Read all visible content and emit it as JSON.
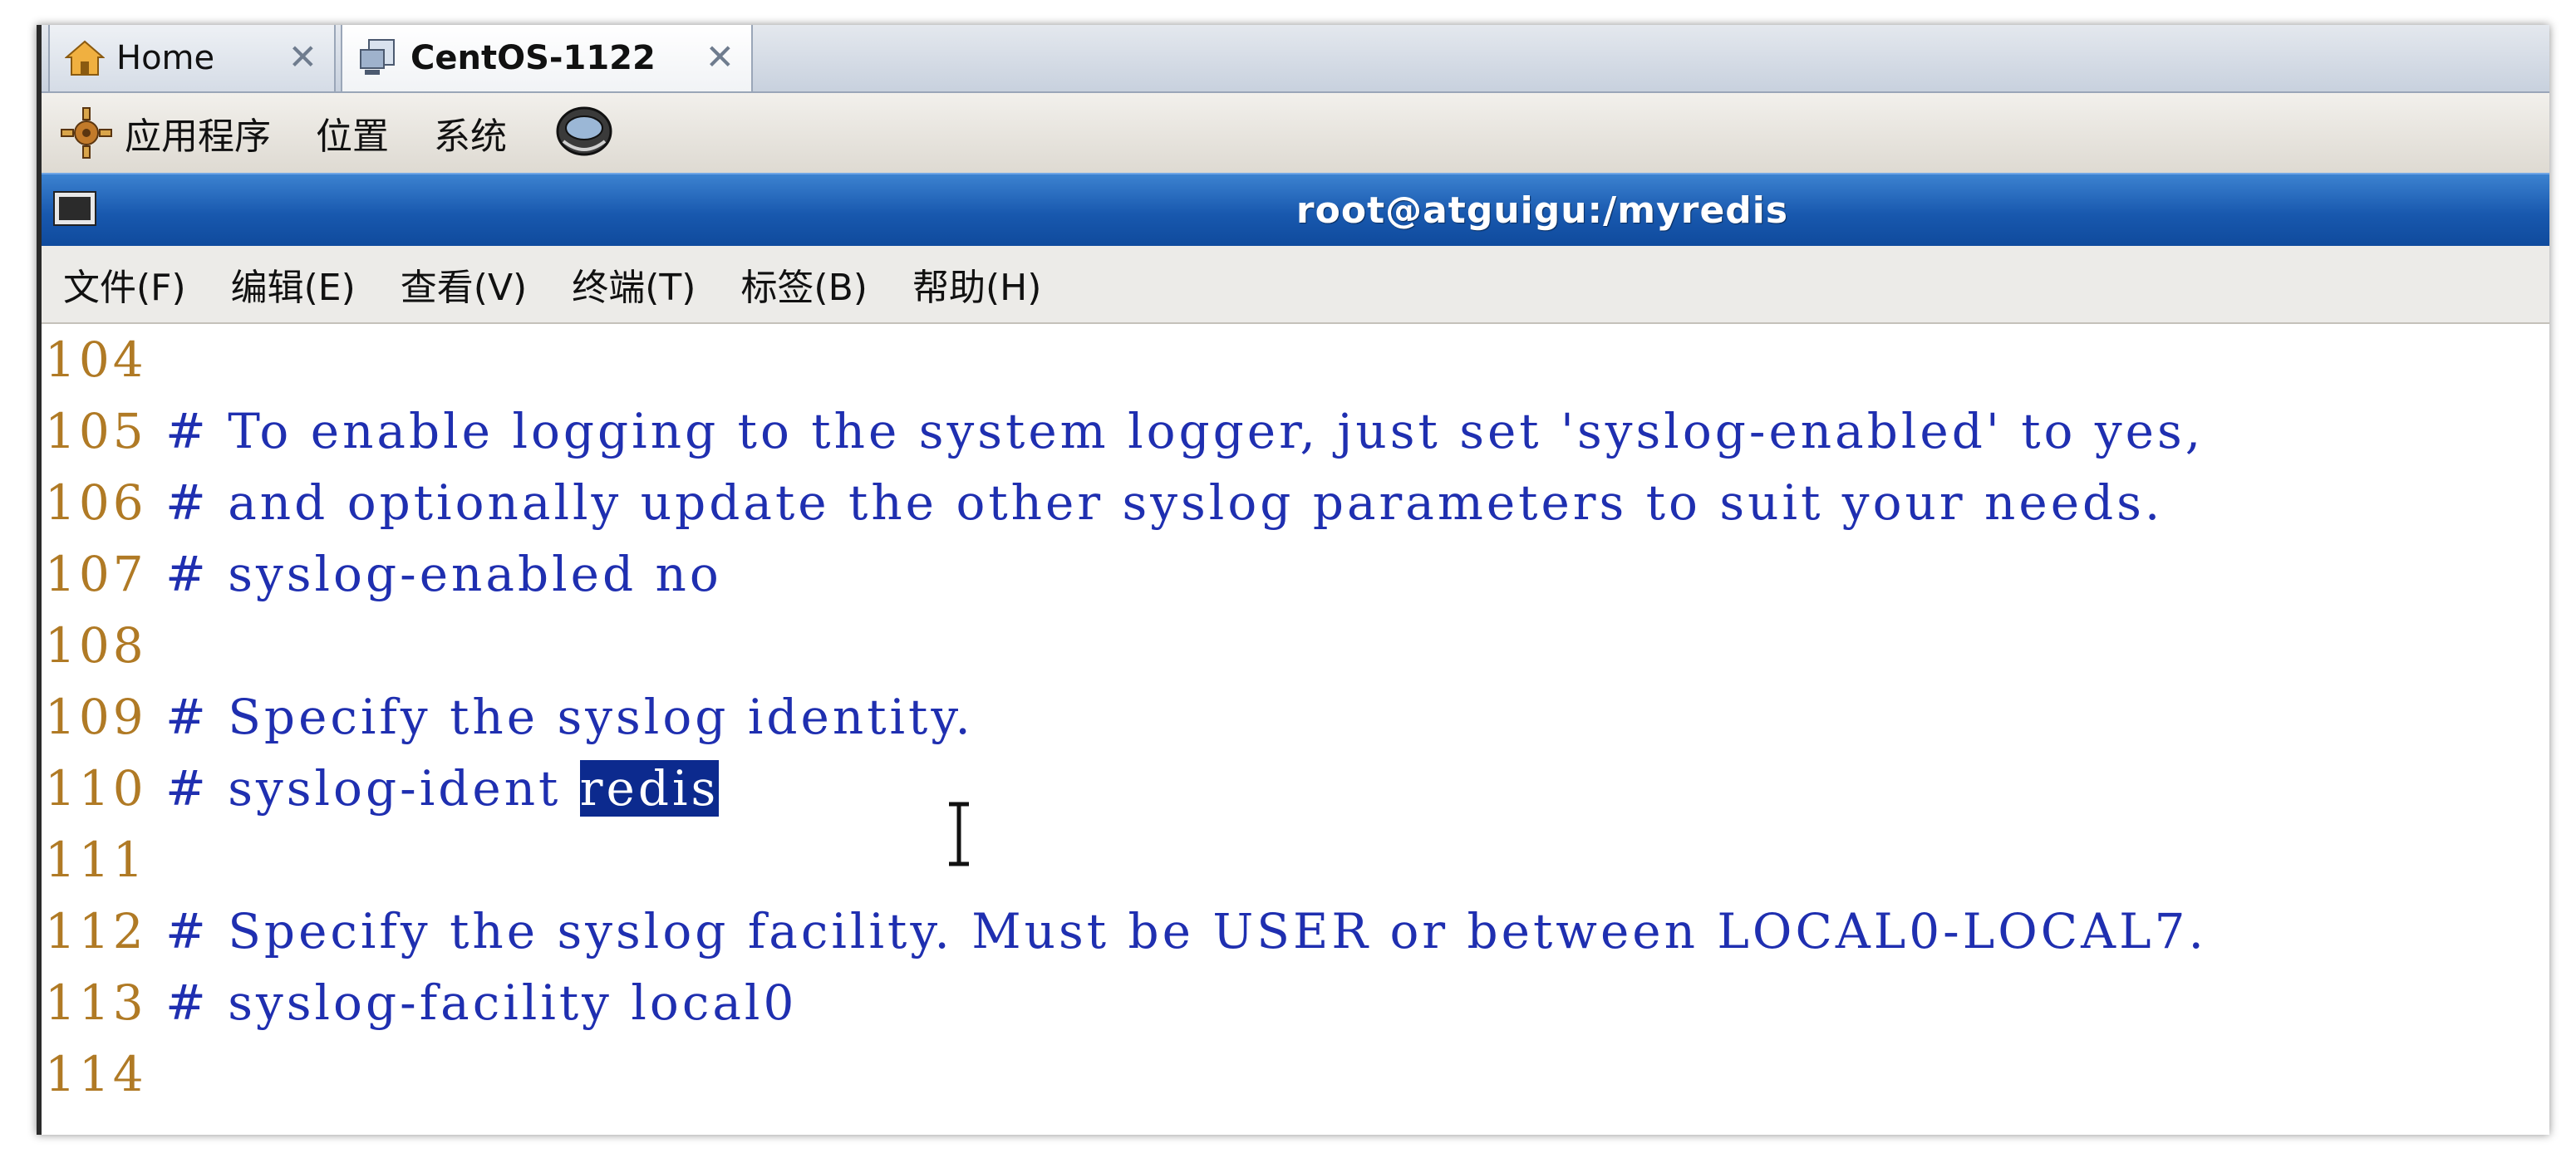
{
  "tabs": [
    {
      "label": "Home",
      "icon": "home-icon"
    },
    {
      "label": "CentOS-1122",
      "icon": "vm-icon"
    }
  ],
  "panel": {
    "items": [
      "应用程序",
      "位置",
      "系统"
    ]
  },
  "window": {
    "title": "root@atguigu:/myredis"
  },
  "menu": {
    "items": [
      "文件(F)",
      "编辑(E)",
      "查看(V)",
      "终端(T)",
      "标签(B)",
      "帮助(H)"
    ]
  },
  "terminal": {
    "lines": [
      {
        "num": "104",
        "hash": "",
        "text": ""
      },
      {
        "num": "105",
        "hash": "#",
        "text": "To enable logging to the system logger, just set 'syslog-enabled' to yes,"
      },
      {
        "num": "106",
        "hash": "#",
        "text": "and optionally update the other syslog parameters to suit your needs."
      },
      {
        "num": "107",
        "hash": "#",
        "text": "syslog-enabled no"
      },
      {
        "num": "108",
        "hash": "",
        "text": ""
      },
      {
        "num": "109",
        "hash": "#",
        "text": "Specify the syslog identity."
      },
      {
        "num": "110",
        "hash": "#",
        "text": "syslog-ident ",
        "highlight": "redis"
      },
      {
        "num": "111",
        "hash": "",
        "text": ""
      },
      {
        "num": "112",
        "hash": "#",
        "text": "Specify the syslog facility. Must be USER or between LOCAL0-LOCAL7."
      },
      {
        "num": "113",
        "hash": "#",
        "text": "syslog-facility local0"
      },
      {
        "num": "114",
        "hash": "",
        "text": ""
      }
    ]
  },
  "colors": {
    "line_number": "#b07a25",
    "comment": "#1f2fb0",
    "selection_bg": "#0c2a8e",
    "title_bar": "#1858ae"
  }
}
